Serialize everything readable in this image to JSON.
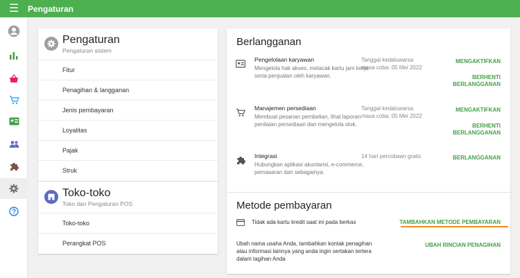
{
  "topbar": {
    "title": "Pengaturan"
  },
  "rail": {
    "items": [
      {
        "icon": "account-circle-icon"
      },
      {
        "icon": "bar-chart-icon",
        "color": "#43a047"
      },
      {
        "icon": "basket-icon",
        "color": "#e91e63"
      },
      {
        "icon": "cart-icon",
        "color": "#29b6f6"
      },
      {
        "icon": "id-card-icon",
        "color": "#43a047"
      },
      {
        "icon": "people-icon",
        "color": "#5c6bc0"
      },
      {
        "icon": "puzzle-icon",
        "color": "#795548"
      },
      {
        "icon": "gear-icon",
        "color": "#757575",
        "active": true
      },
      {
        "icon": "help-icon",
        "color": "#1e88e5"
      }
    ]
  },
  "left": {
    "settings": {
      "title": "Pengaturan",
      "subtitle": "Pengaturan sistem",
      "items": [
        "Fitur",
        "Penagihan & langganan",
        "Jenis pembayaran",
        "Loyalitas",
        "Pajak",
        "Struk"
      ]
    },
    "stores": {
      "title": "Toko-toko",
      "subtitle": "Toko dan Pengaturan POS",
      "items": [
        "Toko-toko",
        "Perangkat POS"
      ]
    }
  },
  "subscriptions": {
    "title": "Berlangganan",
    "items": [
      {
        "name": "Pengelolaan karyawan",
        "description": "Mengelola hak akses, melacak kartu jam kerja serta penjualan oleh karyawan.",
        "date_line1": "Tanggal kedaluwarsa",
        "date_line2": "masa coba: 05 Mei 2022",
        "action1": "MENGAKTIFKAN",
        "action2": "BERHENTI BERLANGGANAN"
      },
      {
        "name": "Manajemen persediaan",
        "description": "Membuat pesanan pembelian, lihat laporan penilaian persediaan dan mengelola stok.",
        "date_line1": "Tanggal kedaluwarsa",
        "date_line2": "masa coba: 05 Mei 2022",
        "action1": "MENGAKTIFKAN",
        "action2": "BERHENTI BERLANGGANAN"
      },
      {
        "name": "Integrasi",
        "description": "Hubungkan aplikasi akuntansi, e-commerce, pemasaran dan sebagainya.",
        "date_line1": "14 hari percobaan gratis",
        "date_line2": "",
        "action1": "BERLANGGANAN",
        "action2": ""
      }
    ]
  },
  "payment": {
    "title": "Metode pembayaran",
    "no_card_text": "Tidak ada kartu kredit saat ini pada berkas",
    "add_action": "TAMBAHKAN METODE PEMBAYARAN",
    "billing_text": "Ubah nama usaha Anda, tambahkan kontak penagihan atau informasi lainnya yang anda ingin sertakan tertera dalam tagihan Anda",
    "billing_action": "UBAH RINCIAN PENAGIHAN"
  },
  "colors": {
    "accent": "#4caf50",
    "action": "#43a047",
    "underline": "#f08a1e"
  }
}
